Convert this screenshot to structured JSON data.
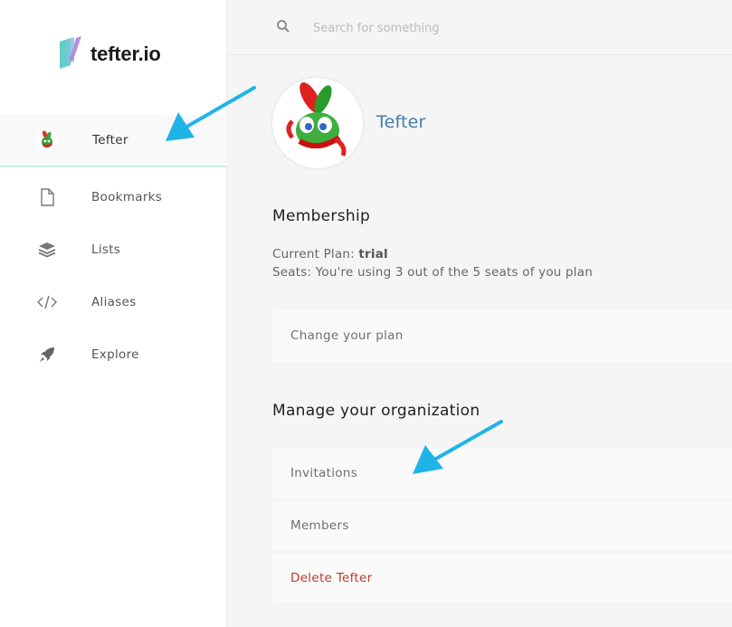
{
  "brand": {
    "name": "tefter.io"
  },
  "sidebar": {
    "items": [
      {
        "label": "Tefter",
        "icon": "team-avatar-icon"
      },
      {
        "label": "Bookmarks",
        "icon": "document-icon"
      },
      {
        "label": "Lists",
        "icon": "layers-icon"
      },
      {
        "label": "Aliases",
        "icon": "code-icon"
      },
      {
        "label": "Explore",
        "icon": "rocket-icon"
      }
    ]
  },
  "search": {
    "placeholder": "Search for something",
    "value": ""
  },
  "org": {
    "name": "Tefter"
  },
  "membership": {
    "title": "Membership",
    "plan_label": "Current Plan:",
    "plan_value": "trial",
    "seats_text": "Seats: You're using 3 out of the 5 seats of you plan",
    "change_plan": "Change your plan"
  },
  "manage": {
    "title": "Manage your organization",
    "invitations": "Invitations",
    "members": "Members",
    "delete": "Delete Tefter"
  },
  "colors": {
    "accent": "#4a7ba8",
    "danger": "#c0392b",
    "annotation_arrow": "#1fb4e8",
    "active_underline": "#cfe9ef"
  }
}
